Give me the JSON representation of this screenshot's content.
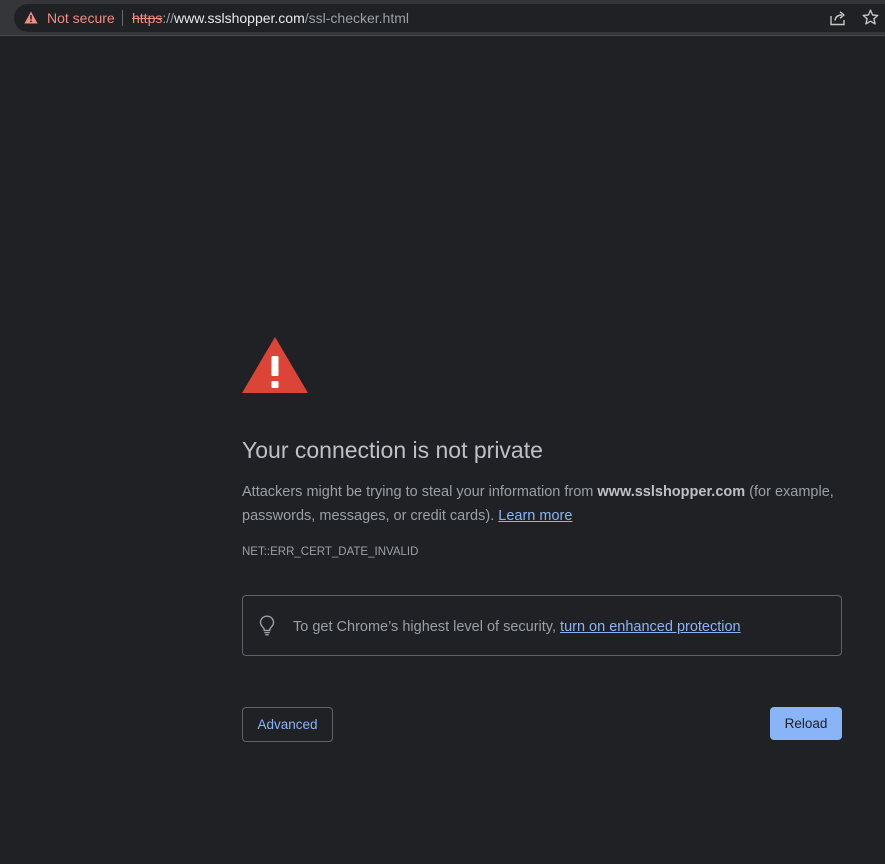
{
  "address_bar": {
    "security_label": "Not secure",
    "url_scheme": "https",
    "url_separator": "://",
    "url_host": "www.sslshopper.com",
    "url_path": "/ssl-checker.html",
    "icons": [
      "warning-icon",
      "share-icon",
      "star-icon"
    ],
    "security_color": "#f28b82"
  },
  "interstitial": {
    "heading": "Your connection is not private",
    "message_before": "Attackers might be trying to steal your information from ",
    "message_host": "www.sslshopper.com",
    "message_after": " (for example, passwords, messages, or credit cards). ",
    "learn_more_label": "Learn more",
    "error_code": "NET::ERR_CERT_DATE_INVALID",
    "protection_text": "To get Chrome’s highest level of security, ",
    "protection_link": "turn on enhanced protection",
    "advanced_label": "Advanced",
    "reload_label": "Reload",
    "warning_color": "#db4437",
    "accent_color": "#8ab4f8",
    "background_color": "#202124"
  }
}
